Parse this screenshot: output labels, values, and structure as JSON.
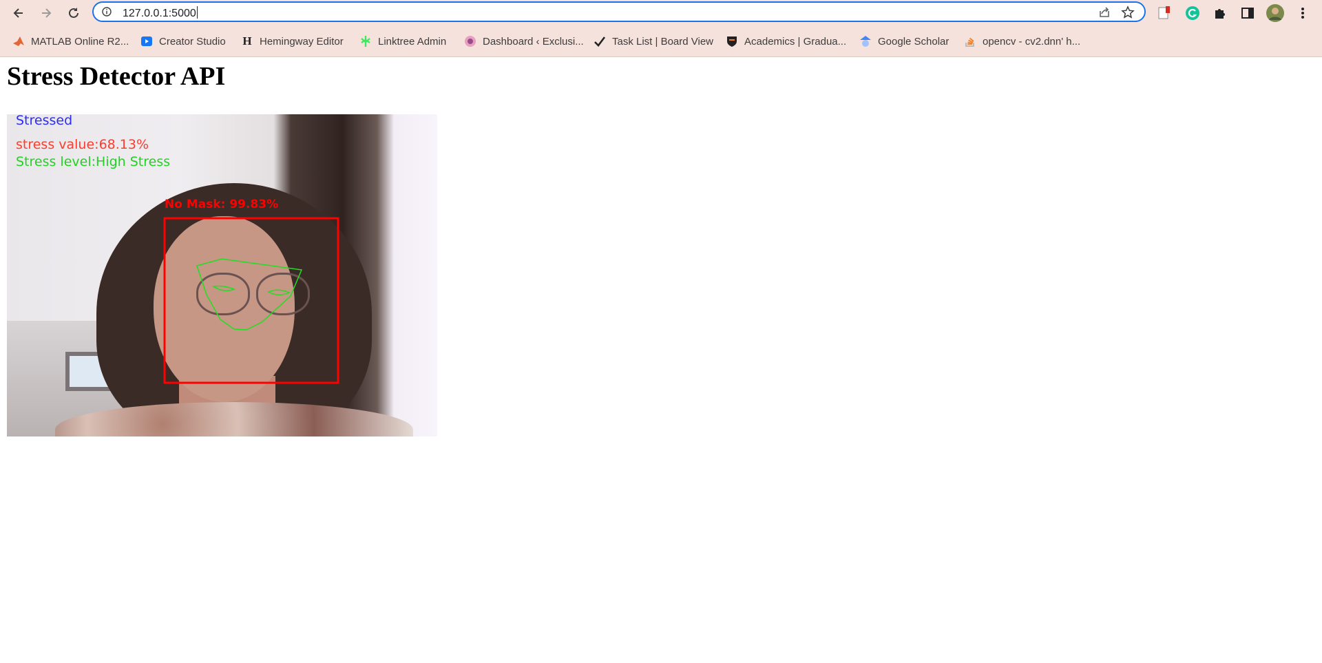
{
  "browser": {
    "url": "127.0.0.1:5000",
    "bookmarks": [
      {
        "label": "MATLAB Online R2...",
        "icon": "matlab-icon"
      },
      {
        "label": "Creator Studio",
        "icon": "creator-studio-icon"
      },
      {
        "label": "Hemingway Editor",
        "icon": "hemingway-icon"
      },
      {
        "label": "Linktree Admin",
        "icon": "linktree-icon"
      },
      {
        "label": "Dashboard ‹ Exclusi...",
        "icon": "dashboard-icon"
      },
      {
        "label": "Task List | Board View",
        "icon": "checkmark-icon"
      },
      {
        "label": "Academics | Gradua...",
        "icon": "princeton-shield-icon"
      },
      {
        "label": "Google Scholar",
        "icon": "google-scholar-icon"
      },
      {
        "label": "opencv - cv2.dnn' h...",
        "icon": "stackoverflow-icon"
      }
    ],
    "colors": {
      "chrome": "#f6e2dc",
      "focus": "#1a73e8"
    }
  },
  "page": {
    "title": "Stress Detector API"
  },
  "feed": {
    "status": "Stressed",
    "stress_value": "stress value:68.13%",
    "stress_level": "Stress level:High Stress",
    "mask_label": "No Mask: 99.83%",
    "colors": {
      "status": "#2b2bff",
      "value": "#ff3b2b",
      "level": "#1fd41f",
      "box": "#ff0000",
      "landmarks": "#22dd22"
    }
  }
}
